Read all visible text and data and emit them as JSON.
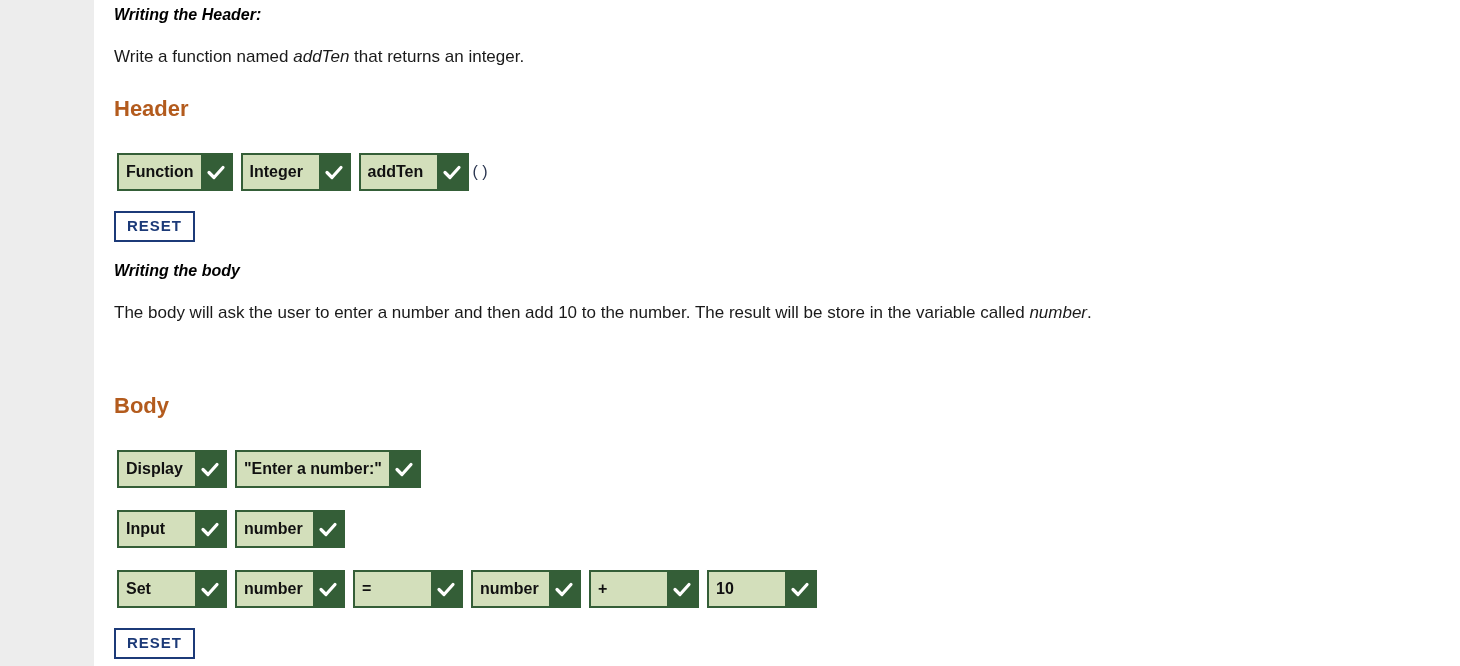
{
  "sections": [
    {
      "intro_title": "Writing the Header:",
      "intro_text": "Write a function named *addTen* that returns an integer.",
      "heading": "Header",
      "rows": [
        {
          "blocks": [
            {
              "label": "Function",
              "correct": true
            },
            {
              "label": "Integer",
              "correct": true
            },
            {
              "label": "addTen",
              "correct": true
            }
          ],
          "suffix": "( )"
        }
      ],
      "reset_button": "RESET"
    },
    {
      "intro_title": "Writing the body",
      "intro_text": "The body will ask the user to enter a number and then add 10 to the number. The result will be store in the variable called *number*.",
      "heading": "Body",
      "rows": [
        {
          "blocks": [
            {
              "label": "Display",
              "correct": true
            },
            {
              "label": "\"Enter a number:\"",
              "correct": true
            }
          ]
        },
        {
          "blocks": [
            {
              "label": "Input",
              "correct": true
            },
            {
              "label": "number",
              "correct": true
            }
          ]
        },
        {
          "blocks": [
            {
              "label": "Set",
              "correct": true
            },
            {
              "label": "number",
              "correct": true
            },
            {
              "label": "=",
              "correct": true
            },
            {
              "label": "number",
              "correct": true
            },
            {
              "label": "+",
              "correct": true
            },
            {
              "label": "10",
              "correct": true
            }
          ]
        }
      ],
      "reset_button": "RESET"
    }
  ]
}
